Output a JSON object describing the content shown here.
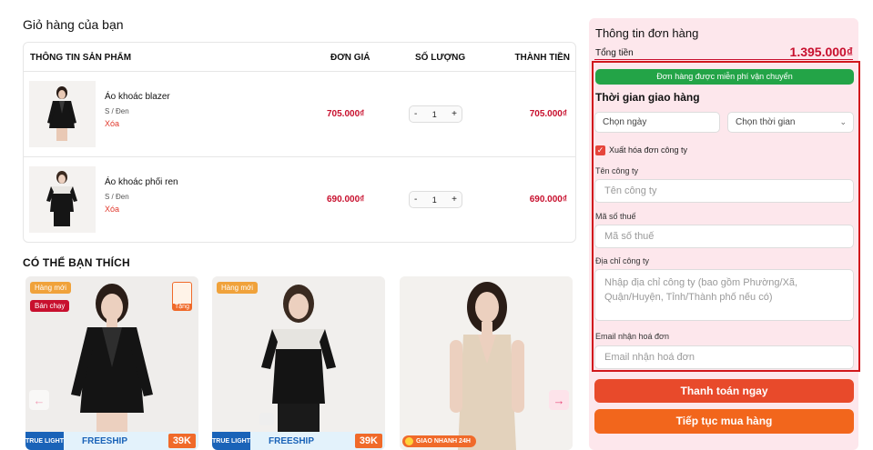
{
  "cart": {
    "title": "Giỏ hàng của bạn",
    "headers": {
      "info": "THÔNG TIN SẢN PHẨM",
      "price": "ĐƠN GIÁ",
      "qty": "SỐ LƯỢNG",
      "total": "THÀNH TIỀN"
    },
    "items": [
      {
        "name": "Áo khoác blazer",
        "variant": "S / Đen",
        "remove": "Xóa",
        "price": "705.000₫",
        "qty": "1",
        "total": "705.000₫"
      },
      {
        "name": "Áo khoác phối ren",
        "variant": "S / Đen",
        "remove": "Xóa",
        "price": "690.000₫",
        "qty": "1",
        "total": "690.000₫"
      }
    ],
    "minus": "-",
    "plus": "+"
  },
  "suggest": {
    "title": "CÓ THỂ BẠN THÍCH",
    "badge_new": "Hàng mới",
    "badge_hot": "Bán chạy",
    "gift": "Tặng",
    "promo_brand": "TRUE LIGHT",
    "promo_freeship": "FREESHIP",
    "promo_amount": "39K",
    "express": "GIAO NHANH 24H",
    "arrow_left": "←",
    "arrow_right": "→"
  },
  "summary": {
    "title": "Thông tin đơn hàng",
    "total_label": "Tổng tiền",
    "total_value": "1.395.000₫",
    "free_ship": "Đơn hàng được miễn phí vận chuyển",
    "delivery_title": "Thời gian giao hàng",
    "date_placeholder": "Chọn ngày",
    "time_placeholder": "Chọn thời gian",
    "invoice_check": "✓",
    "invoice_label": "Xuất hóa đơn công ty",
    "company_label": "Tên công ty",
    "company_placeholder": "Tên công ty",
    "tax_label": "Mã số thuế",
    "tax_placeholder": "Mã số thuế",
    "address_label": "Địa chỉ công ty",
    "address_placeholder": "Nhập địa chỉ công ty (bao gồm Phường/Xã, Quận/Huyện, Tỉnh/Thành phố nếu có)",
    "email_label": "Email nhận hoá đơn",
    "email_placeholder": "Email nhận hoá đơn",
    "pay_button": "Thanh toán ngay",
    "continue_button": "Tiếp tục mua hàng"
  },
  "colors": {
    "accent_red": "#c8102e",
    "green": "#23a447",
    "orange": "#f2661c",
    "panel_pink": "#fde7ec"
  }
}
